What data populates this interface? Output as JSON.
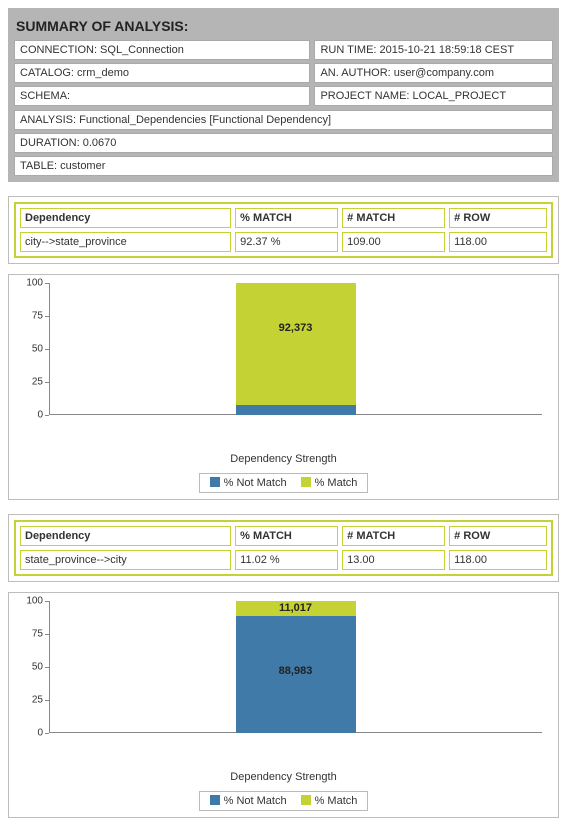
{
  "summary": {
    "title": "SUMMARY OF ANALYSIS:",
    "left": {
      "connection": "CONNECTION: SQL_Connection",
      "catalog": "CATALOG: crm_demo",
      "schema": "SCHEMA:"
    },
    "right": {
      "runtime": "RUN TIME: 2015-10-21 18:59:18 CEST",
      "author": "AN. AUTHOR: user@company.com",
      "project": "PROJECT NAME: LOCAL_PROJECT"
    },
    "full": {
      "analysis": "ANALYSIS: Functional_Dependencies [Functional Dependency]",
      "duration": "DURATION: 0.0670",
      "table": "TABLE: customer"
    }
  },
  "headers": {
    "dep": "Dependency",
    "pmatch": "% MATCH",
    "nmatch": "# MATCH",
    "nrow": "# ROW"
  },
  "deps": [
    {
      "name": "city-->state_province",
      "pmatch": "92.37 %",
      "nmatch": "109.00",
      "nrow": "118.00"
    },
    {
      "name": "state_province-->city",
      "pmatch": "11.02 %",
      "nmatch": "13.00",
      "nrow": "118.00"
    }
  ],
  "axis": {
    "t0": "0",
    "t25": "25",
    "t50": "50",
    "t75": "75",
    "t100": "100"
  },
  "chart_labels": {
    "x_title": "Dependency Strength",
    "legend_notmatch": "% Not Match",
    "legend_match": "% Match"
  },
  "chart_data": [
    {
      "type": "bar",
      "title": "Dependency Strength",
      "categories": [
        "Dependency Strength"
      ],
      "series": [
        {
          "name": "% Not Match",
          "values": [
            7.627
          ],
          "label": ""
        },
        {
          "name": "% Match",
          "values": [
            92.373
          ],
          "label": "92,373"
        }
      ],
      "ylim": [
        0,
        100
      ],
      "stacked": true
    },
    {
      "type": "bar",
      "title": "Dependency Strength",
      "categories": [
        "Dependency Strength"
      ],
      "series": [
        {
          "name": "% Not Match",
          "values": [
            88.983
          ],
          "label": "88,983"
        },
        {
          "name": "% Match",
          "values": [
            11.017
          ],
          "label": "11,017"
        }
      ],
      "ylim": [
        0,
        100
      ],
      "stacked": true
    }
  ]
}
